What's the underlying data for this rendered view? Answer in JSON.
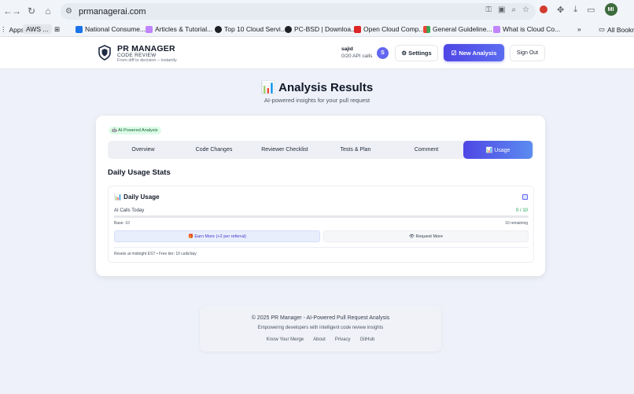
{
  "browser": {
    "url": "prmanagerai.com",
    "bookmarks": [
      {
        "label": "Apps",
        "color": "#5f6368"
      },
      {
        "label": "AWS ...",
        "color": ""
      },
      {
        "label": "National Consume...",
        "color": "#1a73e8"
      },
      {
        "label": "Articles & Tutorial...",
        "color": "#a855f7"
      },
      {
        "label": "Top 10 Cloud Servi...",
        "color": "#202124"
      },
      {
        "label": "PC-BSD | Downloa...",
        "color": "#202124"
      },
      {
        "label": "Open Cloud Comp...",
        "color": "#dc2626"
      },
      {
        "label": "General Guideline...",
        "color": "#f59e0b"
      },
      {
        "label": "What is Cloud Co...",
        "color": "#a855f7"
      },
      {
        "label": "All Bookm",
        "color": ""
      }
    ],
    "more_bookmarks": "»",
    "profile_initials": "MI"
  },
  "header": {
    "brand_title": "PR MANAGER",
    "brand_subtitle": "CODE REVIEW",
    "brand_tagline": "From diff to decision – instantly",
    "user_name": "sajid",
    "user_calls": "0/20 API calls",
    "avatar_letter": "S",
    "settings_label": "Settings",
    "new_analysis_label": "New Analysis",
    "sign_out_label": "Sign Out",
    "accent": "#4f46e5"
  },
  "page": {
    "title": "📊 Analysis Results",
    "subtitle": "AI-powered insights for your pull request"
  },
  "card": {
    "badge": "🤖 AI-Powered Analysis",
    "tabs": [
      {
        "label": "Overview",
        "active": false
      },
      {
        "label": "Code Changes",
        "active": false
      },
      {
        "label": "Reviewer Checklist",
        "active": false
      },
      {
        "label": "Tests & Plan",
        "active": false
      },
      {
        "label": "Comment",
        "active": false
      },
      {
        "label": "📊 Usage",
        "active": true
      }
    ],
    "section_title": "Daily Usage Stats",
    "usage": {
      "title": "📊 Daily Usage",
      "calls_label": "AI Calls Today",
      "calls_count": "0 / 10",
      "progress_fraction": 0,
      "base_label": "Base: 10",
      "remaining_label": "10 remaining",
      "earn_label": "🎁 Earn More (+2 per referral)",
      "request_label": "👁 Request More",
      "reset_note": "Resets at midnight EST • Free tier: 10 calls/day"
    }
  },
  "footer": {
    "copyright": "© 2025 PR Manager - AI-Powered Pull Request Analysis",
    "tagline": "Empowering developers with intelligent code review insights",
    "links": [
      "Know Your Merge",
      "About",
      "Privacy",
      "GitHub"
    ]
  }
}
